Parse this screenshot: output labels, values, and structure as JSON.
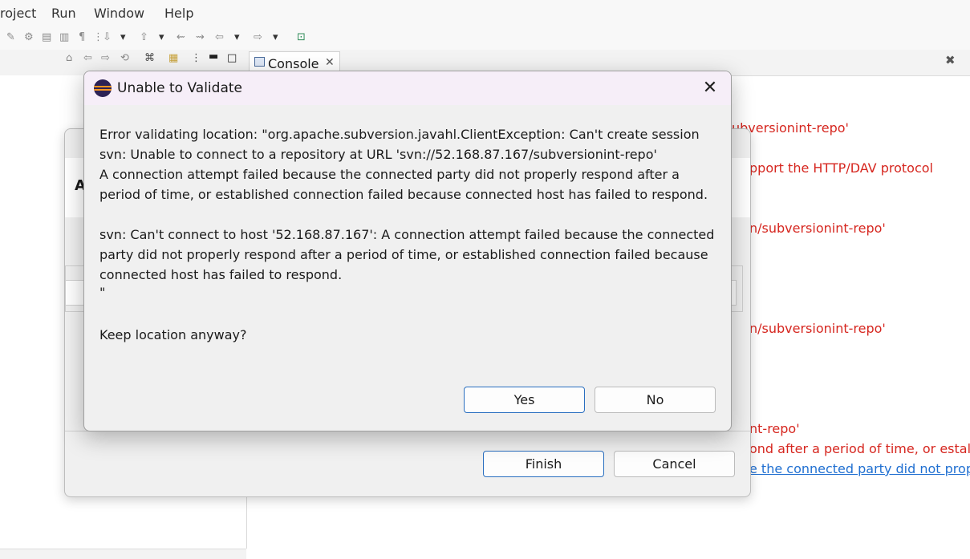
{
  "menu": {
    "items": [
      "roject",
      "Run",
      "Window",
      "Help"
    ]
  },
  "console_tab": {
    "label": "Console"
  },
  "console_lines": [
    "ubversionint-repo'",
    "pport the HTTP/DAV protocol",
    "n/subversionint-repo'",
    "n/subversionint-repo'",
    "nt-repo'",
    "ond after a period of time, or estal"
  ],
  "console_link": "e the connected party did not prop",
  "wizard": {
    "title_fragment": "A",
    "finish_label": "Finish",
    "cancel_label": "Cancel"
  },
  "dialog": {
    "title": "Unable to Validate",
    "message_lines": [
      "Error validating location: \"org.apache.subversion.javahl.ClientException: Can't create session",
      "svn: Unable to connect to a repository at URL 'svn://52.168.87.167/subversionint-repo'",
      "A connection attempt failed because the connected party did not properly respond after a",
      "period of time, or established connection failed because connected host has failed to respond.",
      "",
      "svn: Can't connect to host '52.168.87.167': A connection attempt failed because the connected",
      "party did not properly respond after a period of time, or established connection failed because",
      "connected host has failed to respond.",
      "\""
    ],
    "question": "Keep location anyway?",
    "yes_label": "Yes",
    "no_label": "No"
  }
}
